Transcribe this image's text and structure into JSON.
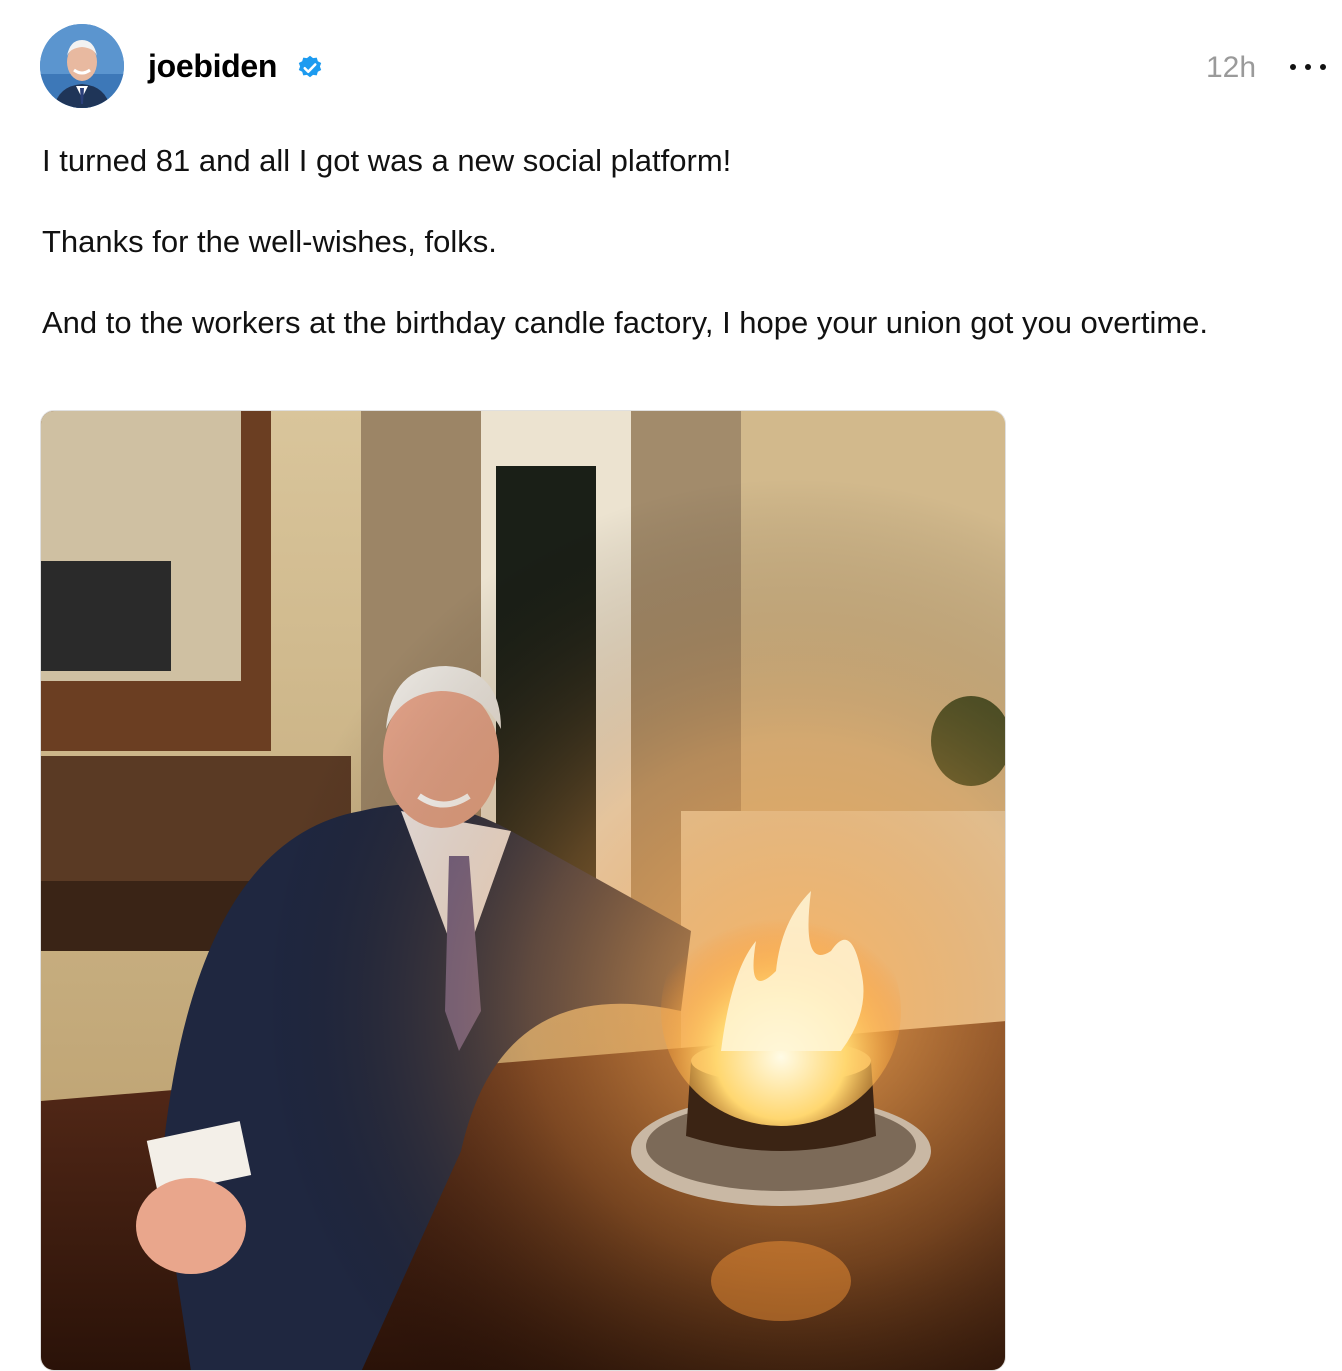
{
  "post": {
    "author": {
      "username": "joebiden",
      "verified": true,
      "verified_icon": "verified-badge-icon",
      "verified_color": "#1d9bf0"
    },
    "timestamp": "12h",
    "more_icon": "more-options-icon",
    "body": {
      "paragraph_1": "I turned 81 and all I got was a new social platform!",
      "paragraph_2": "Thanks for the well-wishes, folks.",
      "paragraph_3": "And to the workers at the birthday candle factory, I hope your union got you overtime."
    },
    "media": {
      "type": "photo"
    }
  },
  "colors": {
    "text": "#111111",
    "timestamp": "#9a9a9a",
    "background": "#ffffff"
  }
}
